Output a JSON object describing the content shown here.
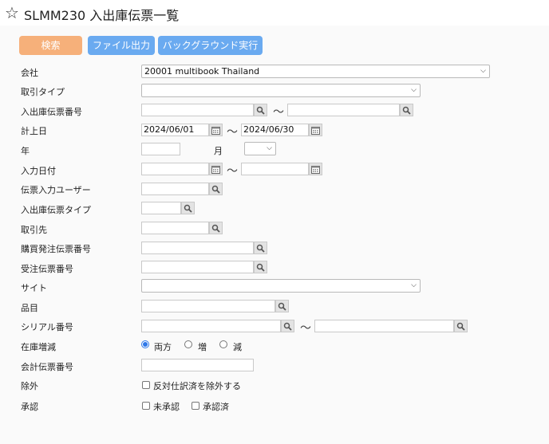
{
  "header": {
    "title": "SLMM230 入出庫伝票一覧"
  },
  "toolbar": {
    "search_label": "検索",
    "file_label": "ファイル出力",
    "bg_label": "バックグラウンド実行"
  },
  "labels": {
    "company": "会社",
    "trade_type": "取引タイプ",
    "voucher_no": "入出庫伝票番号",
    "posting_date": "計上日",
    "year": "年",
    "month": "月",
    "input_date": "入力日付",
    "input_user": "伝票入力ユーザー",
    "voucher_type": "入出庫伝票タイプ",
    "partner": "取引先",
    "po_no": "購買発注伝票番号",
    "so_no": "受注伝票番号",
    "site": "サイト",
    "item": "品目",
    "serial_no": "シリアル番号",
    "stock_change": "在庫増減",
    "acct_voucher": "会計伝票番号",
    "exclusion": "除外",
    "approval": "承認"
  },
  "fields": {
    "company_value": "20001 multibook Thailand",
    "posting_from": "2024/06/01",
    "posting_to": "2024/06/30"
  },
  "tilde": "〜",
  "radios": {
    "both": "両方",
    "increase": "増",
    "decrease": "減"
  },
  "checks": {
    "exclude_reversal": "反対仕訳済を除外する",
    "unapproved": "未承認",
    "approved": "承認済"
  }
}
